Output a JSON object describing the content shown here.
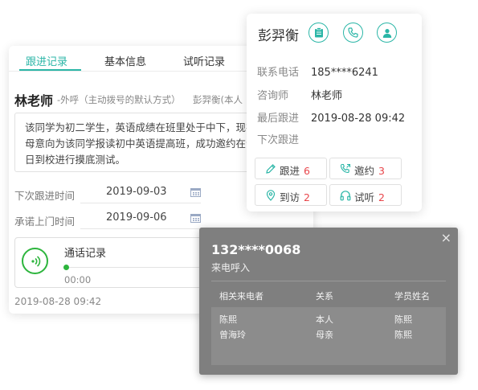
{
  "tabs": [
    "跟进记录",
    "基本信息",
    "试听记录"
  ],
  "record": {
    "teacher": "林老师",
    "meta": "-外呼（主动拨号的默认方式）",
    "owner": "彭羿衡(本人",
    "note": "该同学为初二学生，英语成绩在班里处于中下，现在父母意向为该同学报读初中英语提高班，成功邀约在9月6日到校进行摸底测试。",
    "next_followup_label": "下次跟进时间",
    "next_followup_value": "2019-09-03",
    "visit_promise_label": "承诺上门时间",
    "visit_promise_value": "2019-09-06",
    "call_title": "通话记录",
    "call_time": "00:00",
    "date": "2019-08-28 09:42"
  },
  "contact": {
    "name": "彭羿衡",
    "phone_label": "联系电话",
    "phone_value": "185****6241",
    "advisor_label": "咨询师",
    "advisor_value": "林老师",
    "last_label": "最后跟进",
    "last_value": "2019-08-28 09:42",
    "next_label": "下次跟进",
    "stats": [
      {
        "label": "跟进",
        "count": "6"
      },
      {
        "label": "邀约",
        "count": "3"
      },
      {
        "label": "到访",
        "count": "2"
      },
      {
        "label": "试听",
        "count": "2"
      }
    ]
  },
  "incoming": {
    "close": "×",
    "number": "132****0068",
    "status": "来电呼入",
    "headers": [
      "相关来电者",
      "关系",
      "学员姓名"
    ],
    "rows": [
      [
        "陈熙",
        "本人",
        "陈熙"
      ],
      [
        "曾海玲",
        "母亲",
        "陈熙"
      ]
    ]
  },
  "colors": {
    "accent": "#2bb6a7",
    "call_green": "#2db53d",
    "count_red": "#e8464b"
  }
}
